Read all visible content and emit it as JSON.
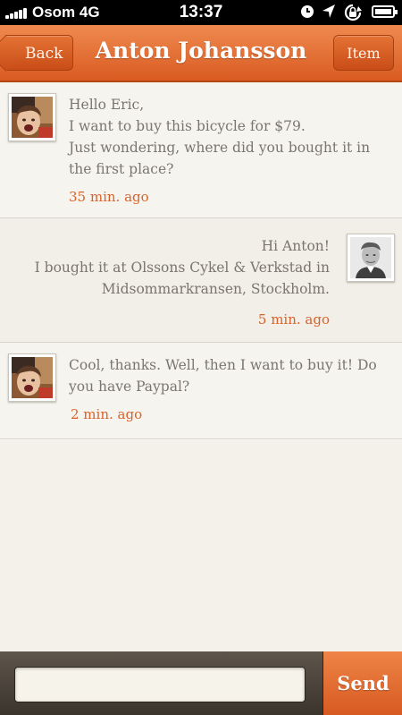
{
  "status_bar": {
    "carrier": "Osom 4G",
    "time": "13:37"
  },
  "nav": {
    "back_label": "Back",
    "title": "Anton Johansson",
    "item_label": "Item"
  },
  "messages": [
    {
      "sender": "Anton",
      "lines": [
        "Hello Eric,",
        "I want to buy this bicycle for $79.",
        "Just wondering, where did you bought it in",
        "the first place?"
      ],
      "time": "35 min. ago",
      "avatar": "anton-avatar"
    },
    {
      "sender": "Eric",
      "lines": [
        "Hi Anton!",
        "I bought it at Olssons Cykel & Verkstad in",
        "Midsommarkransen, Stockholm."
      ],
      "time": "5 min. ago",
      "avatar": "eric-avatar"
    },
    {
      "sender": "Anton",
      "lines": [
        "Cool, thanks. Well, then I want to buy it! Do",
        "you have Paypal?"
      ],
      "time": "2 min. ago",
      "avatar": "anton-avatar"
    }
  ],
  "composer": {
    "placeholder": "",
    "send_label": "Send"
  },
  "colors": {
    "accent": "#e0692d",
    "text": "#7a766e",
    "time": "#d9622a",
    "background": "#f3f1e9"
  }
}
